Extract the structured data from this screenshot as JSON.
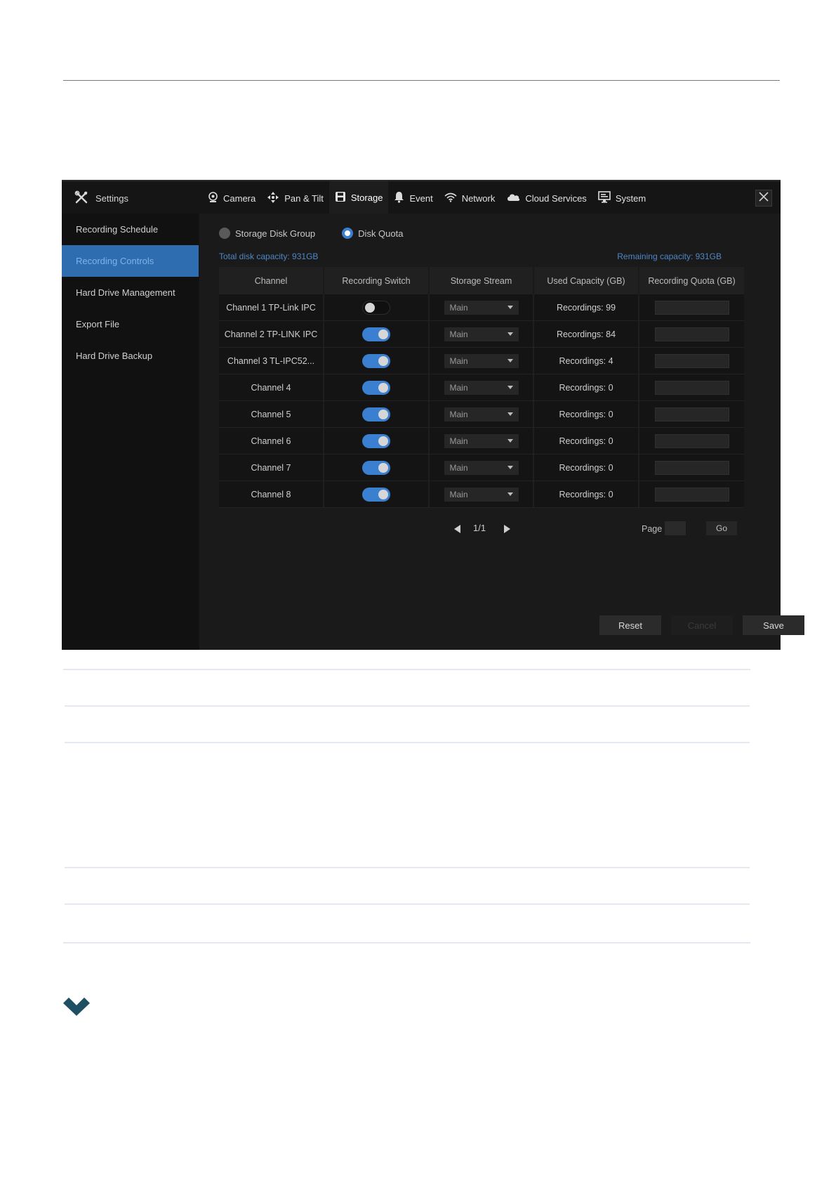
{
  "app": {
    "title": "Settings"
  },
  "tabs": [
    {
      "label": "Camera",
      "icon": "camera-icon"
    },
    {
      "label": "Pan & Tilt",
      "icon": "pan-tilt-icon"
    },
    {
      "label": "Storage",
      "icon": "storage-icon",
      "active": true
    },
    {
      "label": "Event",
      "icon": "bell-icon"
    },
    {
      "label": "Network",
      "icon": "wifi-icon"
    },
    {
      "label": "Cloud Services",
      "icon": "cloud-icon"
    },
    {
      "label": "System",
      "icon": "monitor-icon"
    }
  ],
  "sidebar": {
    "items": [
      {
        "label": "Recording Schedule"
      },
      {
        "label": "Recording Controls",
        "active": true
      },
      {
        "label": "Hard Drive Management"
      },
      {
        "label": "Export File"
      },
      {
        "label": "Hard Drive Backup"
      }
    ]
  },
  "storage_mode": {
    "options": [
      {
        "label": "Storage Disk Group",
        "selected": false
      },
      {
        "label": "Disk Quota",
        "selected": true
      }
    ]
  },
  "capacity": {
    "total": "Total disk capacity: 931GB",
    "remaining": "Remaining capacity: 931GB"
  },
  "table": {
    "headers": [
      "Channel",
      "Recording Switch",
      "Storage Stream",
      "Used Capacity (GB)",
      "Recording Quota (GB)"
    ],
    "rows": [
      {
        "channel": "Channel 1 TP-Link IPC",
        "switch_on": false,
        "stream": "Main",
        "used": "Recordings: 99"
      },
      {
        "channel": "Channel 2 TP-LINK IPC",
        "switch_on": true,
        "stream": "Main",
        "used": "Recordings: 84"
      },
      {
        "channel": "Channel 3 TL-IPC52...",
        "switch_on": true,
        "stream": "Main",
        "used": "Recordings: 4"
      },
      {
        "channel": "Channel 4",
        "switch_on": true,
        "stream": "Main",
        "used": "Recordings: 0"
      },
      {
        "channel": "Channel 5",
        "switch_on": true,
        "stream": "Main",
        "used": "Recordings: 0"
      },
      {
        "channel": "Channel 6",
        "switch_on": true,
        "stream": "Main",
        "used": "Recordings: 0"
      },
      {
        "channel": "Channel 7",
        "switch_on": true,
        "stream": "Main",
        "used": "Recordings: 0"
      },
      {
        "channel": "Channel 8",
        "switch_on": true,
        "stream": "Main",
        "used": "Recordings: 0"
      }
    ]
  },
  "pagination": {
    "current": "1/1",
    "page_label": "Page",
    "go_label": "Go"
  },
  "actions": {
    "reset": "Reset",
    "cancel": "Cancel",
    "save": "Save"
  },
  "colors": {
    "accent": "#3b7fd0",
    "active_sidebar": "#2e6db0",
    "brand_chevron": "#1f4f63"
  }
}
